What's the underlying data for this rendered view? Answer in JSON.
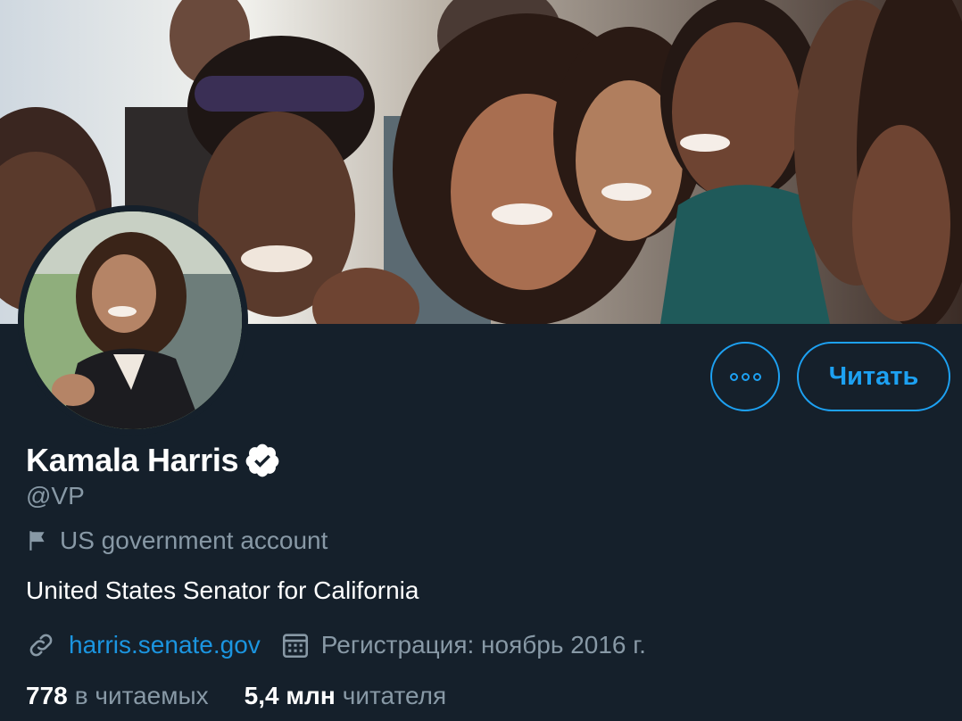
{
  "profile": {
    "display_name": "Kamala Harris",
    "handle": "@VP",
    "label": "US government account",
    "bio": "United States Senator for California",
    "website": "harris.senate.gov",
    "joined": "Регистрация: ноябрь 2016 г."
  },
  "actions": {
    "follow_label": "Читать"
  },
  "stats": {
    "following_value": "778",
    "following_label": "в читаемых",
    "followers_value": "5,4 млн",
    "followers_label": "читателя"
  },
  "icons": {
    "verified": "verified-badge-icon",
    "flag": "flag-icon",
    "link": "link-icon",
    "calendar": "calendar-icon",
    "more": "more-dots-icon"
  },
  "colors": {
    "background": "#15202b",
    "accent": "#1da1f2",
    "link": "#1b95e0",
    "secondary_text": "#8899a6",
    "primary_text": "#ffffff"
  }
}
